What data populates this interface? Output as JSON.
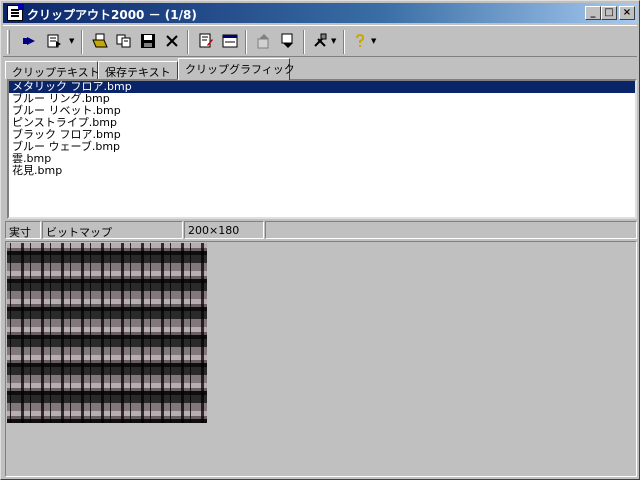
{
  "window": {
    "title": "クリップアウト2000 － (1/8)",
    "min_glyph": "_",
    "max_glyph": "□",
    "close_glyph": "×"
  },
  "toolbar": {
    "items": [
      "run-icon",
      "paste-icon",
      "open-icon",
      "copy-icon",
      "save-icon",
      "delete-icon",
      "edit-icon",
      "view-icon",
      "move-up-icon",
      "move-down-icon",
      "tools-icon",
      "help-icon"
    ]
  },
  "tabs": [
    {
      "label": "クリップテキスト",
      "active": false
    },
    {
      "label": "保存テキスト",
      "active": false
    },
    {
      "label": "クリップグラフィック",
      "active": true
    }
  ],
  "list": {
    "items": [
      "メタリック フロア.bmp",
      "ブルー リング.bmp",
      "ブルー リベット.bmp",
      "ピンストライプ.bmp",
      "ブラック フロア.bmp",
      "ブルー ウェーブ.bmp",
      "雲.bmp",
      "花見.bmp"
    ],
    "selected_index": 0
  },
  "status": {
    "mode": "実寸",
    "type": "ビットマップ",
    "size": "200×180",
    "extra": ""
  },
  "colors": {
    "title_bar": "#0a246a",
    "selection": "#0a246a",
    "face": "#c0c0c0"
  }
}
